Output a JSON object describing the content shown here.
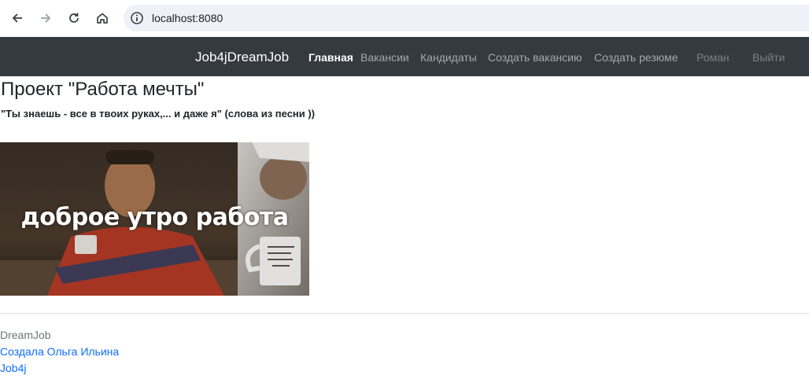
{
  "browser": {
    "url": "localhost:8080",
    "icons": [
      "back-icon",
      "forward-icon",
      "reload-icon",
      "home-icon",
      "info-icon"
    ]
  },
  "navbar": {
    "brand": "Job4jDreamJob",
    "links": [
      {
        "label": "Главная",
        "active": true
      },
      {
        "label": "Вакансии"
      },
      {
        "label": "Кандидаты"
      },
      {
        "label": "Создать вакансию"
      },
      {
        "label": "Создать резюме"
      }
    ],
    "user": "Роман",
    "logout": "Выйти",
    "background": "#343a40"
  },
  "main": {
    "title": "Проект \"Работа мечты\"",
    "subtitle": "\"Ты знаешь - все в твоих руках,... и даже я\" (слова из песни ))",
    "image_caption": "доброе утро работа"
  },
  "footer": {
    "brand": "DreamJob",
    "author_link": "Создала Ольга Ильина",
    "org_link": "Job4j",
    "link_color": "#0d6efd"
  }
}
